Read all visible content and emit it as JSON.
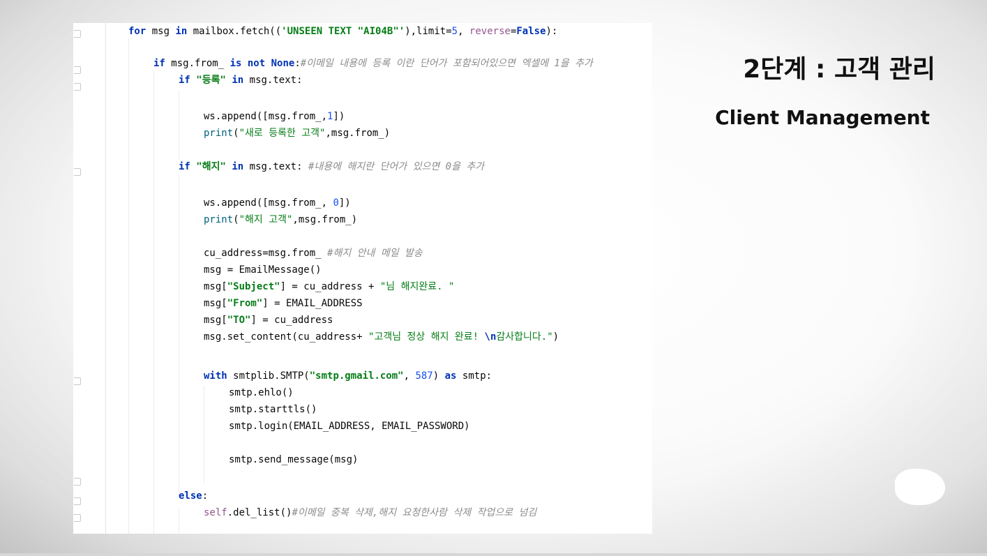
{
  "slide": {
    "title_ko": "2단계 : 고객 관리",
    "title_en": "Client Management"
  },
  "code": [
    [
      [
        "kw",
        "for "
      ],
      [
        "",
        "msg "
      ],
      [
        "kw",
        "in "
      ],
      [
        "",
        "mailbox.fetch(("
      ],
      [
        "strb",
        "'UNSEEN TEXT \"AI04B\"'"
      ],
      [
        "",
        "),limit="
      ],
      [
        "num",
        "5"
      ],
      [
        "",
        ", "
      ],
      [
        "ps",
        "reverse"
      ],
      [
        "",
        "="
      ],
      [
        "kw",
        "False"
      ],
      [
        "",
        "):"
      ]
    ],
    [
      [
        "kw",
        "if "
      ],
      [
        "",
        "msg.from_ "
      ],
      [
        "kw",
        "is not None"
      ],
      [
        "",
        ":"
      ],
      [
        "cm",
        "#이메일 내용에 등록 이란 단어가 포함되어있으면 엑셀에 1을 추가"
      ]
    ],
    [
      [
        "kw",
        "if "
      ],
      [
        "strb",
        "\"등록\""
      ],
      [
        "kw",
        " in "
      ],
      [
        "",
        "msg.text:"
      ]
    ],
    [
      [
        "",
        "ws.append([msg.from_,"
      ],
      [
        "num",
        "1"
      ],
      [
        "",
        "])"
      ]
    ],
    [
      [
        "fn",
        "print"
      ],
      [
        "",
        "("
      ],
      [
        "str",
        "\"새로 등록한 고객\""
      ],
      [
        "",
        ",msg.from_)"
      ]
    ],
    [
      [
        "kw",
        "if "
      ],
      [
        "strb",
        "\"해지\""
      ],
      [
        "kw",
        " in "
      ],
      [
        "",
        "msg.text: "
      ],
      [
        "cm",
        "#내용에 해지란 단어가 있으면 0을 추가"
      ]
    ],
    [
      [
        "",
        "ws.append([msg.from_, "
      ],
      [
        "num",
        "0"
      ],
      [
        "",
        "])"
      ]
    ],
    [
      [
        "fn",
        "print"
      ],
      [
        "",
        "("
      ],
      [
        "str",
        "\"해지 고객\""
      ],
      [
        "",
        ",msg.from_)"
      ]
    ],
    [
      [
        "",
        "cu_address=msg.from_ "
      ],
      [
        "cm",
        "#해지 안내 메일 발송"
      ]
    ],
    [
      [
        "",
        "msg = EmailMessage()"
      ]
    ],
    [
      [
        "",
        "msg["
      ],
      [
        "strb",
        "\"Subject\""
      ],
      [
        "",
        "] = cu_address + "
      ],
      [
        "str",
        "\"님 해지완료. \""
      ]
    ],
    [
      [
        "",
        "msg["
      ],
      [
        "strb",
        "\"From\""
      ],
      [
        "",
        "] = EMAIL_ADDRESS"
      ]
    ],
    [
      [
        "",
        "msg["
      ],
      [
        "strb",
        "\"TO\""
      ],
      [
        "",
        "] = cu_address"
      ]
    ],
    [
      [
        "",
        "msg.set_content(cu_address+ "
      ],
      [
        "str",
        "\"고객님 정상 해지 완료! "
      ],
      [
        "kw",
        "\\n"
      ],
      [
        "str",
        "감사합니다.\""
      ],
      [
        "",
        ")"
      ]
    ],
    [
      [
        "kw",
        "with "
      ],
      [
        "",
        "smtplib.SMTP("
      ],
      [
        "strb",
        "\"smtp.gmail.com\""
      ],
      [
        "",
        ", "
      ],
      [
        "num",
        "587"
      ],
      [
        "",
        ") "
      ],
      [
        "kw",
        "as "
      ],
      [
        "",
        "smtp:"
      ]
    ],
    [
      [
        "",
        "smtp.ehlo()"
      ]
    ],
    [
      [
        "",
        "smtp.starttls()"
      ]
    ],
    [
      [
        "",
        "smtp.login(EMAIL_ADDRESS, EMAIL_PASSWORD)"
      ]
    ],
    [
      [
        "",
        "smtp.send_message(msg)"
      ]
    ],
    [
      [
        "kw",
        "else"
      ],
      [
        "",
        ":"
      ]
    ],
    [
      [
        "ps",
        "self"
      ],
      [
        "",
        ".del_list()"
      ],
      [
        "cm",
        "#이메일 중복 삭제,해지 요청한사람 삭제 작업으로 넘김"
      ]
    ]
  ],
  "colors": {
    "keyword": "#0033b3",
    "string": "#067d17",
    "number": "#1750eb",
    "comment": "#8c8c8c",
    "builtin": "#00627a",
    "param_self": "#94558d"
  }
}
